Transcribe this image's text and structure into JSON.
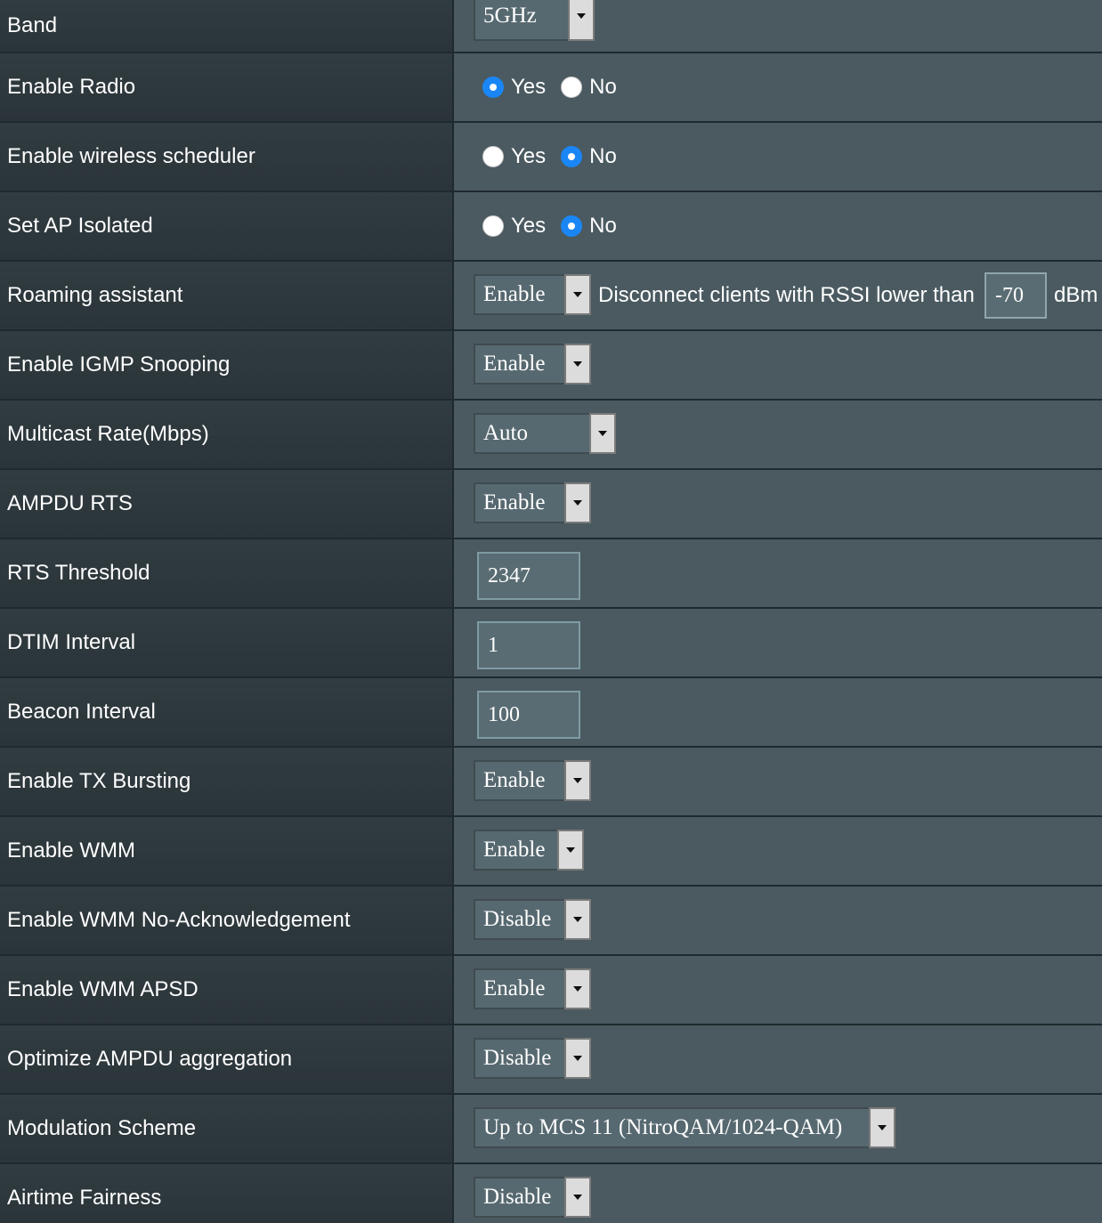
{
  "rows": [
    {
      "label": "Band",
      "value": "5GHz"
    },
    {
      "label": "Enable Radio",
      "yes": "Yes",
      "no": "No",
      "selected": "Yes"
    },
    {
      "label": "Enable wireless scheduler",
      "yes": "Yes",
      "no": "No",
      "selected": "No"
    },
    {
      "label": "Set AP Isolated",
      "yes": "Yes",
      "no": "No",
      "selected": "No"
    },
    {
      "label": "Roaming assistant",
      "value": "Enable",
      "text": "Disconnect clients with RSSI lower than",
      "rssi": "-70",
      "unit": "dBm"
    },
    {
      "label": "Enable IGMP Snooping",
      "value": "Enable"
    },
    {
      "label": "Multicast Rate(Mbps)",
      "value": "Auto"
    },
    {
      "label": "AMPDU RTS",
      "value": "Enable"
    },
    {
      "label": "RTS Threshold",
      "value": "2347"
    },
    {
      "label": "DTIM Interval",
      "value": "1"
    },
    {
      "label": "Beacon Interval",
      "value": "100"
    },
    {
      "label": "Enable TX Bursting",
      "value": "Enable"
    },
    {
      "label": "Enable WMM",
      "value": "Enable"
    },
    {
      "label": "Enable WMM No-Acknowledgement",
      "value": "Disable"
    },
    {
      "label": "Enable WMM APSD",
      "value": "Enable"
    },
    {
      "label": "Optimize AMPDU aggregation",
      "value": "Disable"
    },
    {
      "label": "Modulation Scheme",
      "value": "Up to MCS 11 (NitroQAM/1024-QAM)"
    },
    {
      "label": "Airtime Fairness",
      "value": "Disable"
    }
  ]
}
